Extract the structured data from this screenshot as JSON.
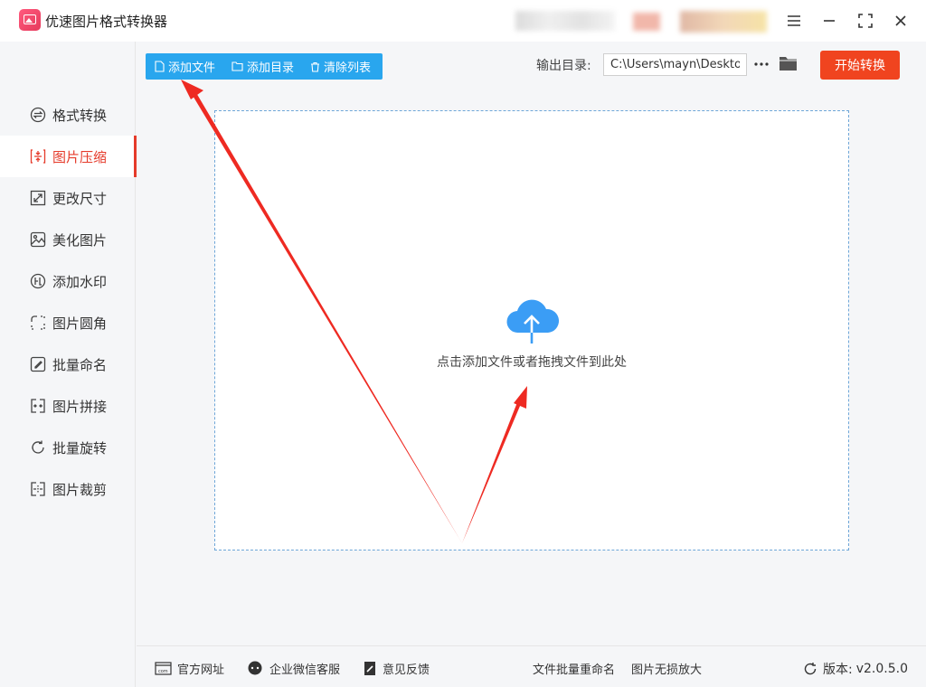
{
  "app": {
    "title": "优速图片格式转换器"
  },
  "sidebar": {
    "items": [
      {
        "label": "格式转换",
        "icon": "swap-circle-icon"
      },
      {
        "label": "图片压缩",
        "icon": "compress-icon"
      },
      {
        "label": "更改尺寸",
        "icon": "resize-icon"
      },
      {
        "label": "美化图片",
        "icon": "beautify-icon"
      },
      {
        "label": "添加水印",
        "icon": "watermark-icon"
      },
      {
        "label": "图片圆角",
        "icon": "rounded-corner-icon"
      },
      {
        "label": "批量命名",
        "icon": "rename-icon"
      },
      {
        "label": "图片拼接",
        "icon": "splice-icon"
      },
      {
        "label": "批量旋转",
        "icon": "rotate-icon"
      },
      {
        "label": "图片裁剪",
        "icon": "crop-icon"
      }
    ],
    "active": "图片压缩"
  },
  "toolbar": {
    "add_file": "添加文件",
    "add_folder": "添加目录",
    "clear_list": "清除列表"
  },
  "output": {
    "label": "输出目录:",
    "path": "C:\\Users\\mayn\\Desktop"
  },
  "start_button": "开始转换",
  "dropzone": {
    "hint": "点击添加文件或者拖拽文件到此处"
  },
  "footer": {
    "website": "官方网址",
    "wechat_support": "企业微信客服",
    "feedback": "意见反馈",
    "batch_rename": "文件批量重命名",
    "lossless_enlarge": "图片无损放大",
    "version_label": "版本:",
    "version": "v2.0.5.0"
  },
  "colors": {
    "accent": "#e53b2b",
    "toolbar_blue": "#29a6ee",
    "start_button": "#f0441f",
    "cloud_blue": "#3b9df5",
    "annotation_red": "#ee2a22"
  }
}
